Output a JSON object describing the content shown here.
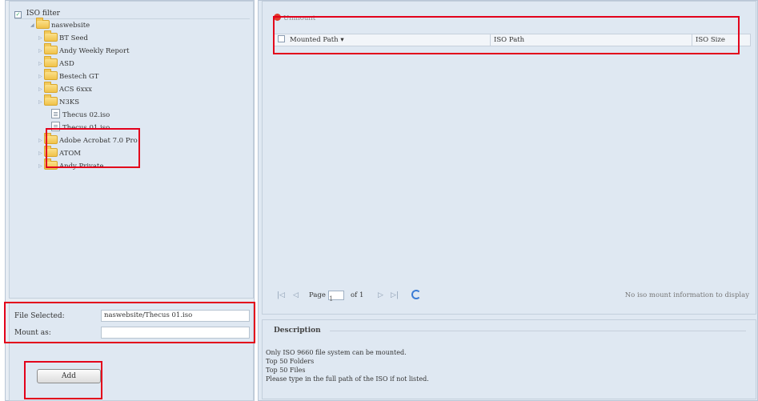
{
  "tree": {
    "header_label": "ISO filter",
    "root": "naswebsite",
    "items": [
      {
        "label": "BT Seed",
        "type": "folder"
      },
      {
        "label": "Andy Weekly Report",
        "type": "folder"
      },
      {
        "label": "ASD",
        "type": "folder"
      },
      {
        "label": "Bestech GT",
        "type": "folder"
      },
      {
        "label": "ACS 6xxx",
        "type": "folder"
      },
      {
        "label": "N3KS",
        "type": "folder"
      },
      {
        "label": "Thecus 02.iso",
        "type": "iso"
      },
      {
        "label": "Thecus 01.iso",
        "type": "iso"
      },
      {
        "label": "Adobe Acrobat 7.0 Pro",
        "type": "folder"
      },
      {
        "label": "ATOM",
        "type": "folder"
      },
      {
        "label": "Andy Private",
        "type": "folder"
      }
    ]
  },
  "form": {
    "file_selected_label": "File Selected:",
    "file_selected_value": "naswebsite/Thecus 01.iso",
    "mount_as_label": "Mount as:",
    "mount_as_value": "",
    "add_label": "Add"
  },
  "grid": {
    "unmount_label": "Unmount",
    "columns": [
      "Mounted Path",
      "ISO Path",
      "ISO Size"
    ],
    "sort_indicator": "▾"
  },
  "pager": {
    "first": "|◁",
    "prev": "◁",
    "page_label": "Page",
    "page_value": "1",
    "of_label": "of 1",
    "next": "▷",
    "last": "▷|",
    "status": "No iso mount information to display"
  },
  "description": {
    "title": "Description",
    "lines": [
      "Only ISO 9660 file system can be mounted.",
      "Top 50 Folders",
      "Top 50 Files",
      "Please type in the full path of the ISO if not listed."
    ]
  }
}
